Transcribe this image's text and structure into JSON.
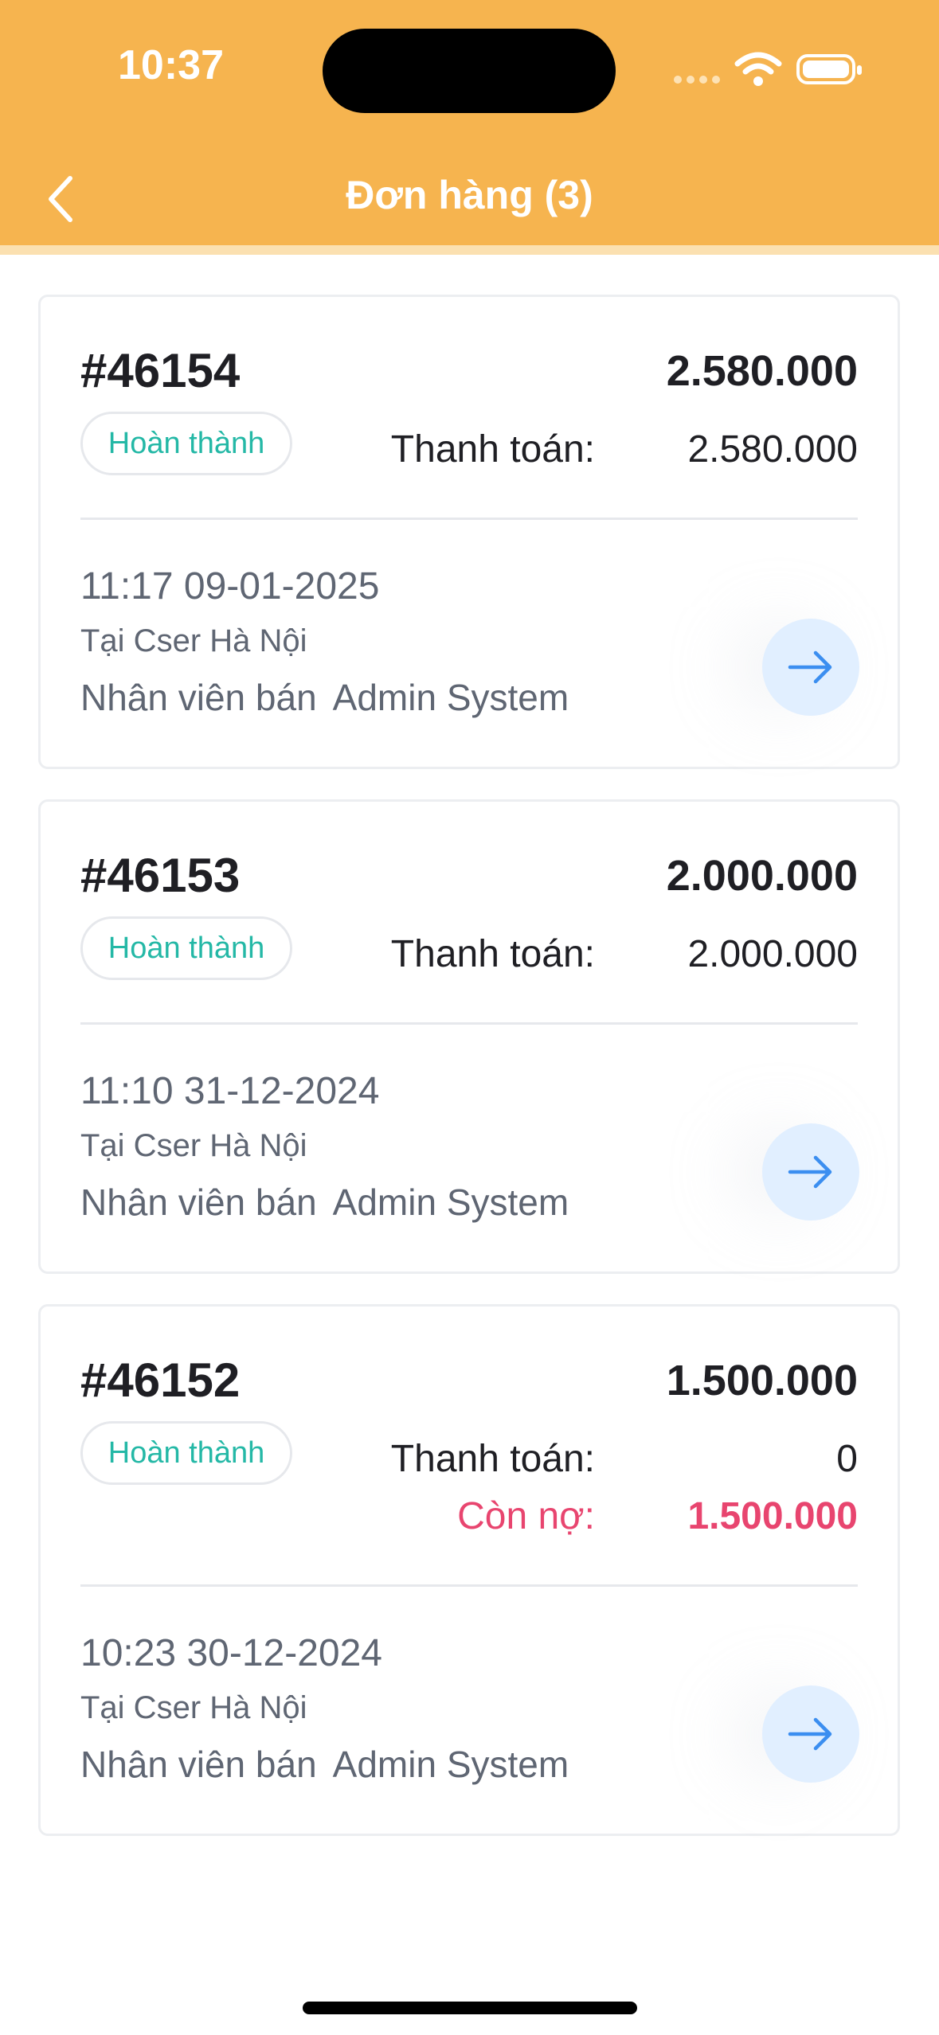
{
  "status_bar": {
    "time": "10:37"
  },
  "header": {
    "title": "Đơn hàng (3)"
  },
  "labels": {
    "payment": "Thanh toán:",
    "debt": "Còn nợ:",
    "seller": "Nhân viên bán"
  },
  "orders": [
    {
      "id": "#46154",
      "total": "2.580.000",
      "status": "Hoàn thành",
      "paid": "2.580.000",
      "datetime": "11:17 09-01-2025",
      "store": "Tại Cser Hà Nội",
      "seller_name": "Admin System"
    },
    {
      "id": "#46153",
      "total": "2.000.000",
      "status": "Hoàn thành",
      "paid": "2.000.000",
      "datetime": "11:10 31-12-2024",
      "store": "Tại Cser Hà Nội",
      "seller_name": "Admin System"
    },
    {
      "id": "#46152",
      "total": "1.500.000",
      "status": "Hoàn thành",
      "paid": "0",
      "debt": "1.500.000",
      "datetime": "10:23 30-12-2024",
      "store": "Tại Cser Hà Nội",
      "seller_name": "Admin System"
    }
  ],
  "colors": {
    "header": "#f6b44f",
    "status_complete": "#24b8a6",
    "debt": "#e8456f",
    "arrow_button_bg": "#e1efff",
    "arrow": "#3b8ef0"
  }
}
